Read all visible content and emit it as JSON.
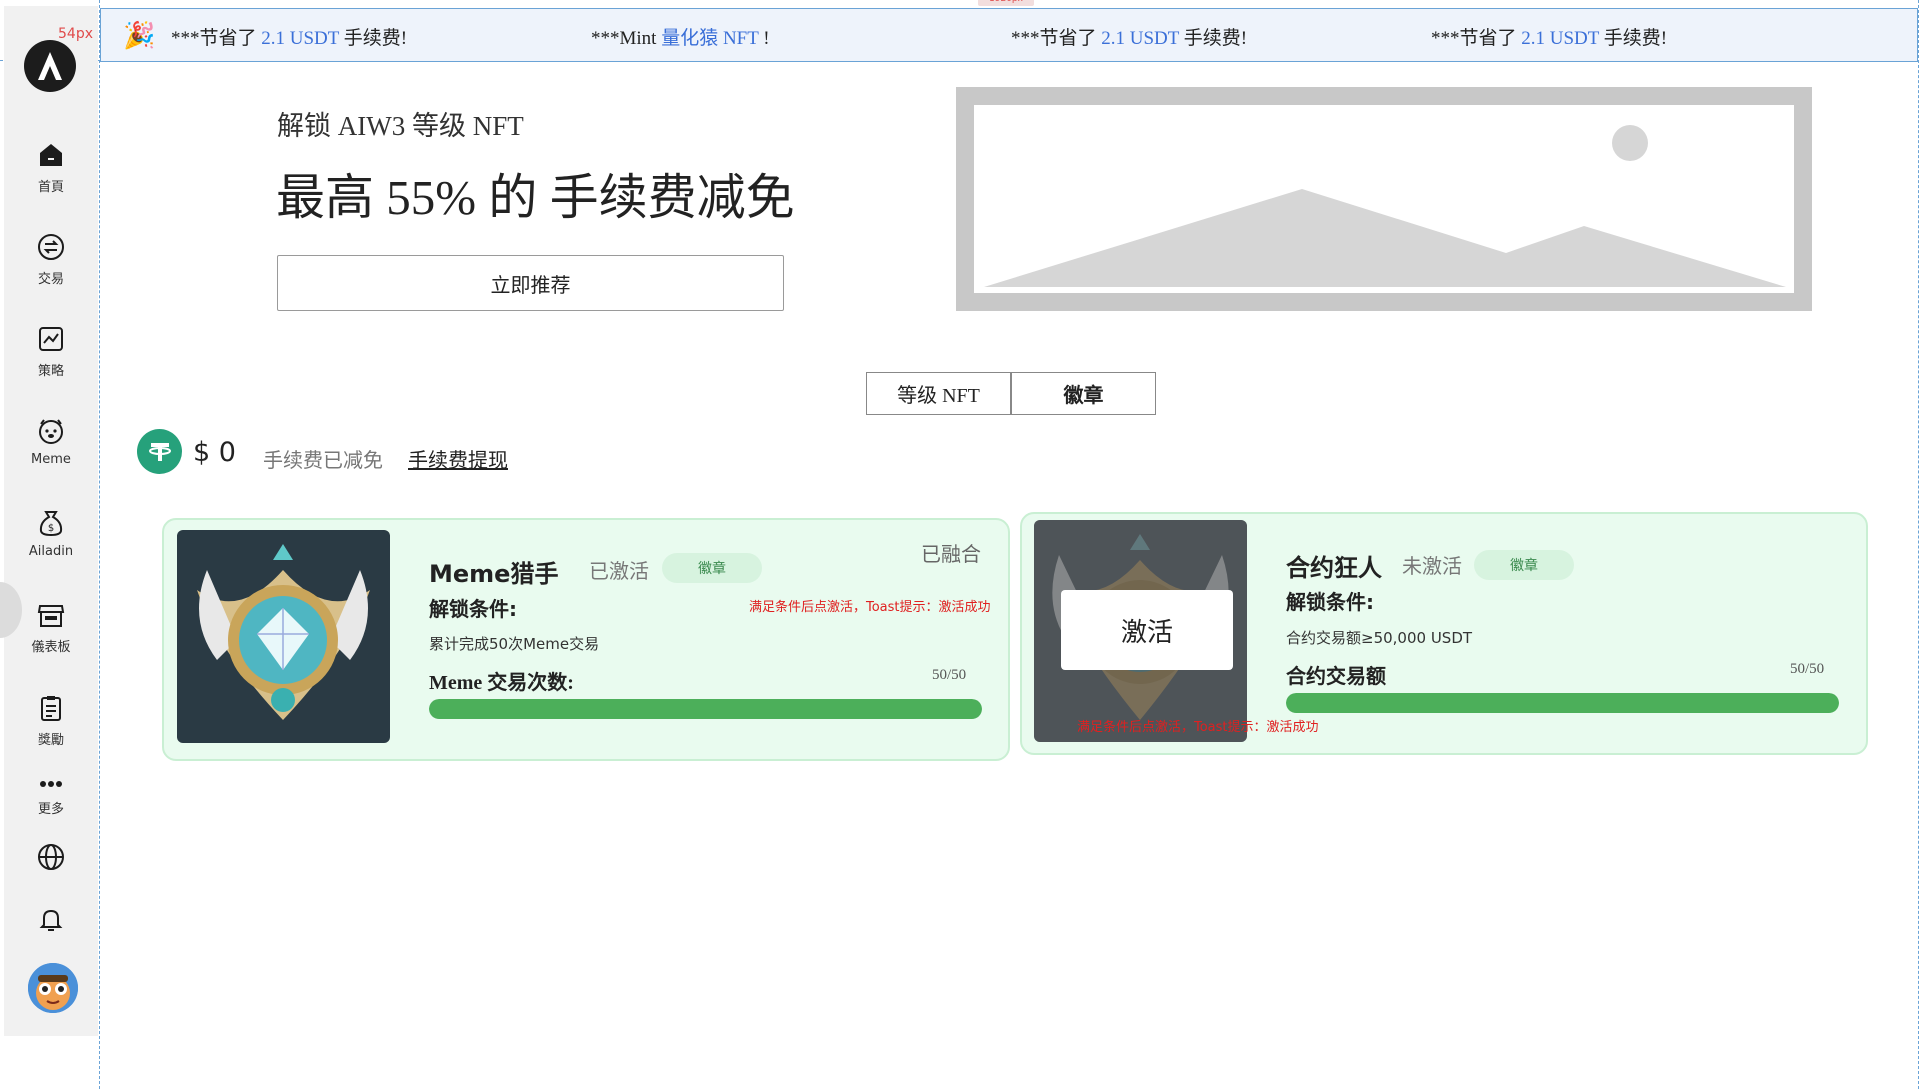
{
  "annotations": {
    "width_tag": "54px",
    "top_tag": "1920px"
  },
  "sidebar": {
    "items": [
      {
        "label": "首頁",
        "icon": "home-icon"
      },
      {
        "label": "交易",
        "icon": "swap-icon"
      },
      {
        "label": "策略",
        "icon": "chart-icon"
      },
      {
        "label": "Meme",
        "icon": "dog-icon"
      },
      {
        "label": "Ailadin",
        "icon": "money-bag-icon"
      },
      {
        "label": "儀表板",
        "icon": "storefront-icon"
      },
      {
        "label": "獎勵",
        "icon": "clipboard-icon"
      },
      {
        "label": "更多",
        "icon": "more-icon"
      }
    ],
    "utility_icons": [
      "globe-icon",
      "bell-icon",
      "avatar"
    ]
  },
  "ticker": {
    "messages": [
      {
        "prefix": "***节省了 ",
        "highlight": "2.1 USDT",
        "suffix": " 手续费!"
      },
      {
        "prefix": "***Mint ",
        "highlight": "量化猿 NFT",
        "suffix": " !"
      },
      {
        "prefix": "***节省了 ",
        "highlight": "2.1 USDT",
        "suffix": " 手续费!"
      },
      {
        "prefix": "***节省了 ",
        "highlight": "2.1 USDT",
        "suffix": " 手续费!"
      }
    ]
  },
  "hero": {
    "subtitle": "解锁 AIW3 等级 NFT",
    "title": "最高 55% 的 手续费减免",
    "cta": "立即推荐"
  },
  "tabs": [
    {
      "label": "等级 NFT",
      "active": false
    },
    {
      "label": "徽章",
      "active": true
    }
  ],
  "savings": {
    "amount": "$ 0",
    "label": "手续费已减免",
    "withdraw": "手续费提现"
  },
  "cards": [
    {
      "title": "Meme猎手",
      "status": "已激活",
      "pill": "徽章",
      "merged": "已融合",
      "condition_label": "解锁条件:",
      "condition": "累计完成50次Meme交易",
      "metric_label": "Meme 交易次数:",
      "progress_text": "50/50",
      "progress": 1.0,
      "note": "满足条件后点激活，Toast提示：激活成功"
    },
    {
      "title": "合约狂人",
      "status": "未激活",
      "pill": "徽章",
      "condition_label": "解锁条件:",
      "condition": "合约交易额≥50,000 USDT",
      "metric_label": "合约交易额",
      "progress_text": "50/50",
      "progress": 1.0,
      "activate": "激活",
      "note": "满足条件后点激活，Toast提示：激活成功"
    }
  ],
  "colors": {
    "accent_green": "#4caf5a",
    "card_bg": "#e9fbef",
    "link_blue": "#3a6fd8",
    "note_red": "#e02020"
  }
}
